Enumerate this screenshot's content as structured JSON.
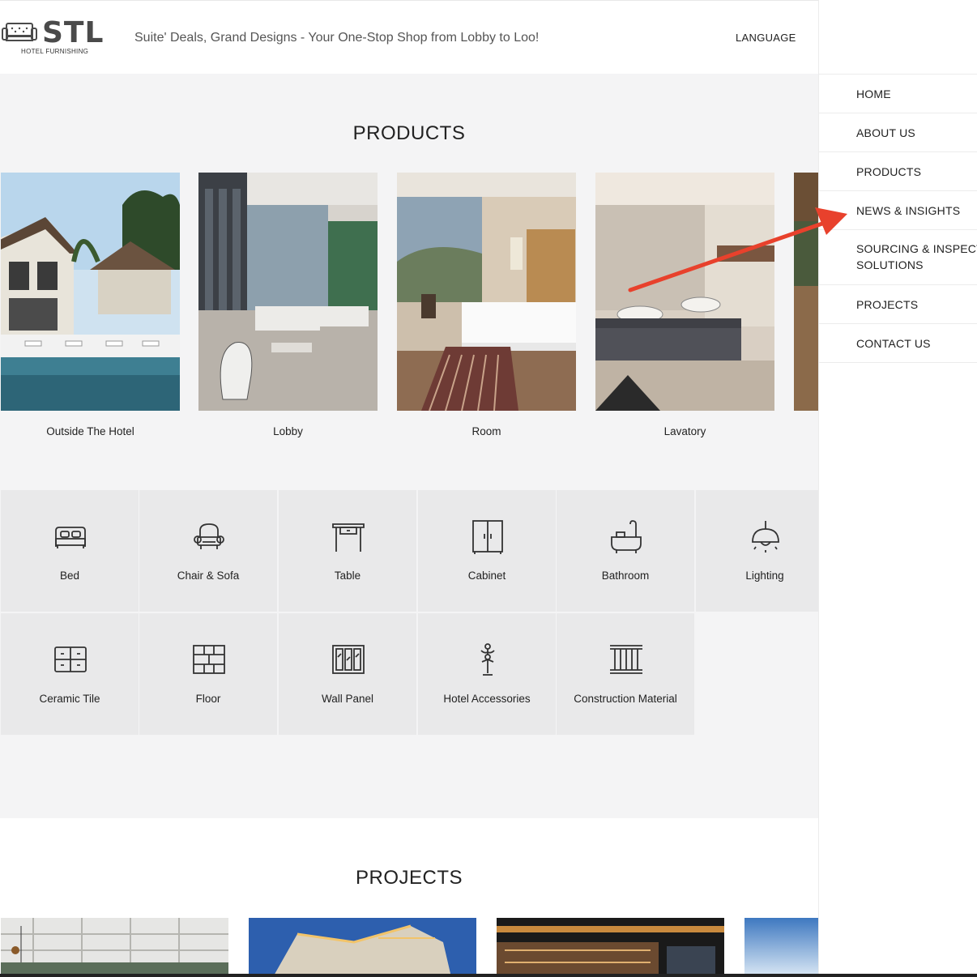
{
  "header": {
    "logo_text": "STL",
    "logo_sub": "HOTEL FURNISHING",
    "tagline": "Suite' Deals, Grand Designs - Your One-Stop Shop from Lobby to Loo!",
    "language": "LANGUAGE"
  },
  "menu": {
    "items": [
      {
        "label": "HOME"
      },
      {
        "label": "ABOUT US"
      },
      {
        "label": "PRODUCTS"
      },
      {
        "label": "NEWS & INSIGHTS"
      },
      {
        "label": "SOURCING & INSPECTI",
        "label2": "SOLUTIONS"
      },
      {
        "label": "PROJECTS"
      },
      {
        "label": "CONTACT US"
      }
    ]
  },
  "products": {
    "title": "PRODUCTS",
    "categories": [
      {
        "label": "Outside The Hotel"
      },
      {
        "label": "Lobby"
      },
      {
        "label": "Room"
      },
      {
        "label": "Lavatory"
      }
    ],
    "tiles": [
      {
        "label": "Bed",
        "icon": "bed-icon"
      },
      {
        "label": "Chair & Sofa",
        "icon": "armchair-icon"
      },
      {
        "label": "Table",
        "icon": "table-icon"
      },
      {
        "label": "Cabinet",
        "icon": "cabinet-icon"
      },
      {
        "label": "Bathroom",
        "icon": "bathtub-icon"
      },
      {
        "label": "Lighting",
        "icon": "lamp-icon"
      },
      {
        "label": "Ceramic Tile",
        "icon": "tile-icon"
      },
      {
        "label": "Floor",
        "icon": "floor-icon"
      },
      {
        "label": "Wall Panel",
        "icon": "wall-panel-icon"
      },
      {
        "label": "Hotel Accessories",
        "icon": "coat-stand-icon"
      },
      {
        "label": "Construction Material",
        "icon": "construction-icon"
      }
    ]
  },
  "projects": {
    "title": "PROJECTS"
  },
  "colors": {
    "accent_arrow": "#e8412c",
    "section_bg": "#f4f4f5",
    "tile_bg": "#e9e9ea"
  }
}
